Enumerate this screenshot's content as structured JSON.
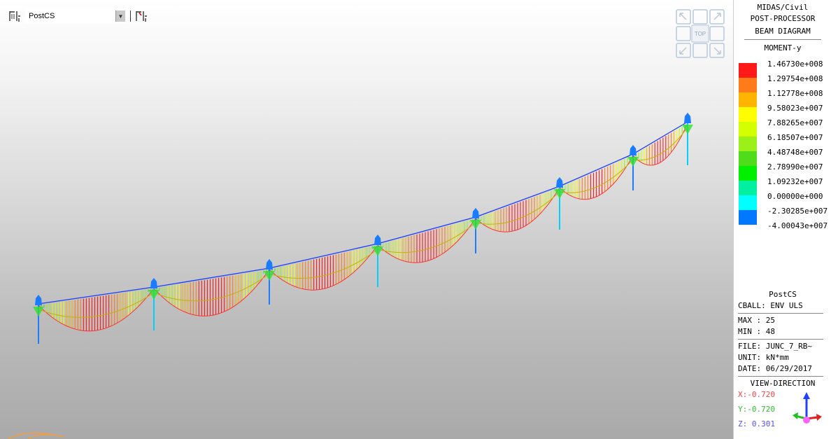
{
  "toolbar": {
    "load_case": "PostCS"
  },
  "navigation_cube": {
    "label": "TOP"
  },
  "panel": {
    "header": [
      "MIDAS/Civil",
      "POST-PROCESSOR",
      "BEAM DIAGRAM"
    ],
    "component": "MOMENT-y",
    "legend": [
      {
        "value": "1.46730e+008",
        "color": "#ff1a1a"
      },
      {
        "value": "1.29754e+008",
        "color": "#ff7b1a"
      },
      {
        "value": "1.12778e+008",
        "color": "#ffb400"
      },
      {
        "value": "9.58023e+007",
        "color": "#ffff00"
      },
      {
        "value": "7.88265e+007",
        "color": "#d4ff00"
      },
      {
        "value": "6.18507e+007",
        "color": "#9bf01a"
      },
      {
        "value": "4.48748e+007",
        "color": "#4fdc1a"
      },
      {
        "value": "2.78990e+007",
        "color": "#00f000"
      },
      {
        "value": "1.09232e+007",
        "color": "#00f0a0"
      },
      {
        "value": "0.00000e+000",
        "color": "#00ffff"
      },
      {
        "value": "-2.30285e+007",
        "color": "#0078ff"
      },
      {
        "value": "-4.00043e+007",
        "color": null
      }
    ],
    "stage": "PostCS",
    "combination": "CBALL: ENV  ULS",
    "max": "MAX : 25",
    "min": "MIN : 48",
    "file": "FILE: JUNC_7_RB~",
    "unit": "UNIT: kN*mm",
    "date": "DATE: 06/29/2017",
    "view_direction_title": "VIEW-DIRECTION",
    "view_x": "X:-0.720",
    "view_y": "Y:-0.720",
    "view_z": "Z: 0.301",
    "colors": {
      "x": "#ff4040",
      "y": "#40e040",
      "z": "#4040ff"
    }
  }
}
